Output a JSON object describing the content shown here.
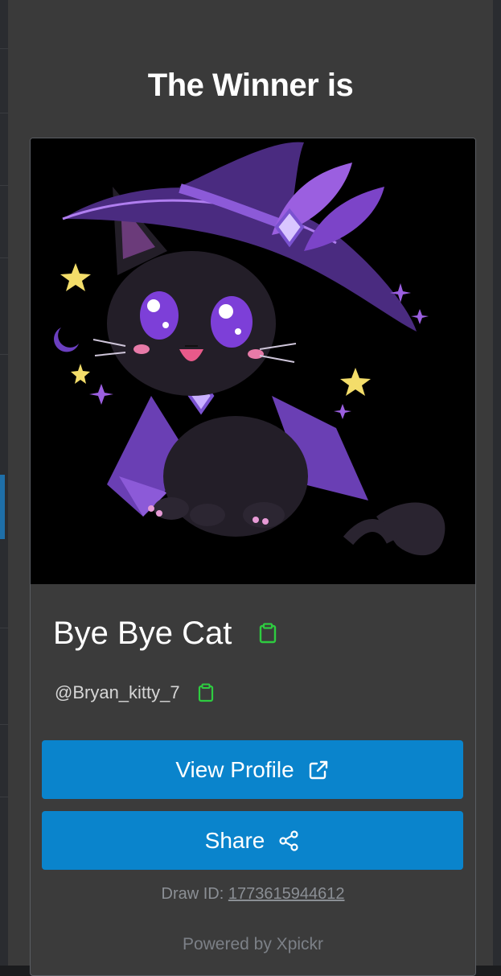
{
  "modal": {
    "title": "The Winner is"
  },
  "winner": {
    "name": "Bye Bye Cat",
    "handle": "@Bryan_kitty_7",
    "image_alt": "Black cat in purple witch hat and cape"
  },
  "buttons": {
    "view_profile_label": "View Profile",
    "share_label": "Share"
  },
  "draw": {
    "id_label": "Draw ID:",
    "id_value": "1773615944612"
  },
  "footer": {
    "powered_by": "Powered by Xpickr"
  },
  "icons": {
    "copy_name": "clipboard-icon",
    "copy_handle": "clipboard-icon",
    "external_link": "external-link-icon",
    "share": "share-icon"
  },
  "colors": {
    "modal_bg": "#3a3a3a",
    "button_bg": "#0a84cc",
    "copy_icon": "#2ecc40",
    "muted_text": "#8b8f95"
  }
}
